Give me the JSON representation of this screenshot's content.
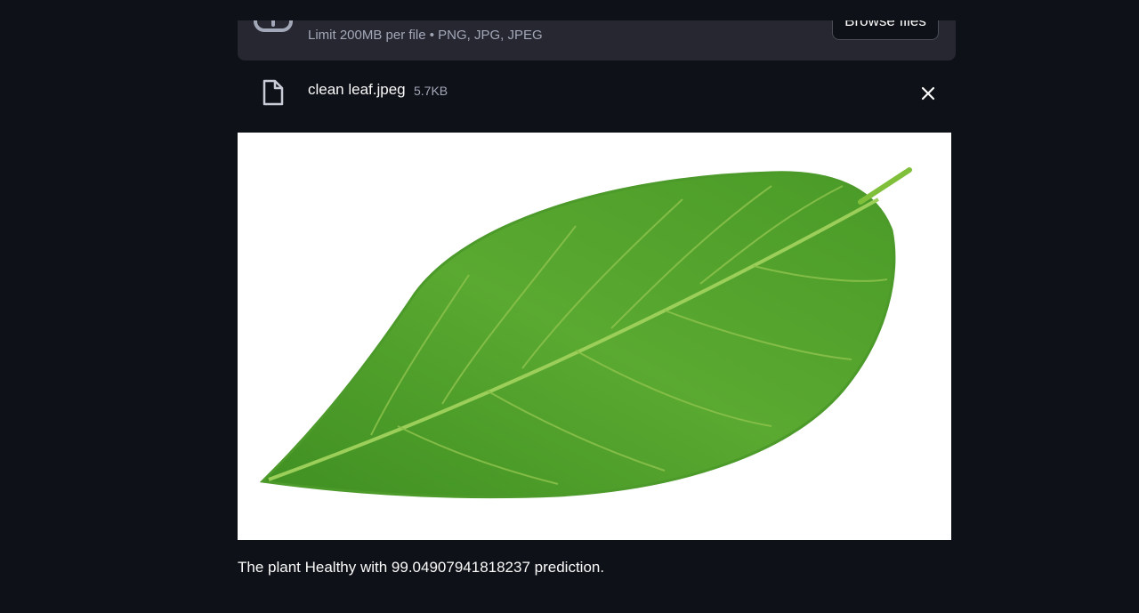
{
  "uploader": {
    "upload_icon": "cloud-upload-icon",
    "limit_text": "Limit 200MB per file • PNG, JPG, JPEG",
    "browse_label": "Browse files"
  },
  "file": {
    "file_icon": "file-icon",
    "name": "clean leaf.jpeg",
    "size": "5.7KB",
    "close_icon": "close-icon"
  },
  "image": {
    "subject": "green leaf"
  },
  "result": {
    "text": "The plant Healthy with 99.04907941818237 prediction."
  },
  "colors": {
    "background": "#0e1117",
    "dropzone": "#262730",
    "text": "#fafafa",
    "muted": "#a3a8b8"
  }
}
